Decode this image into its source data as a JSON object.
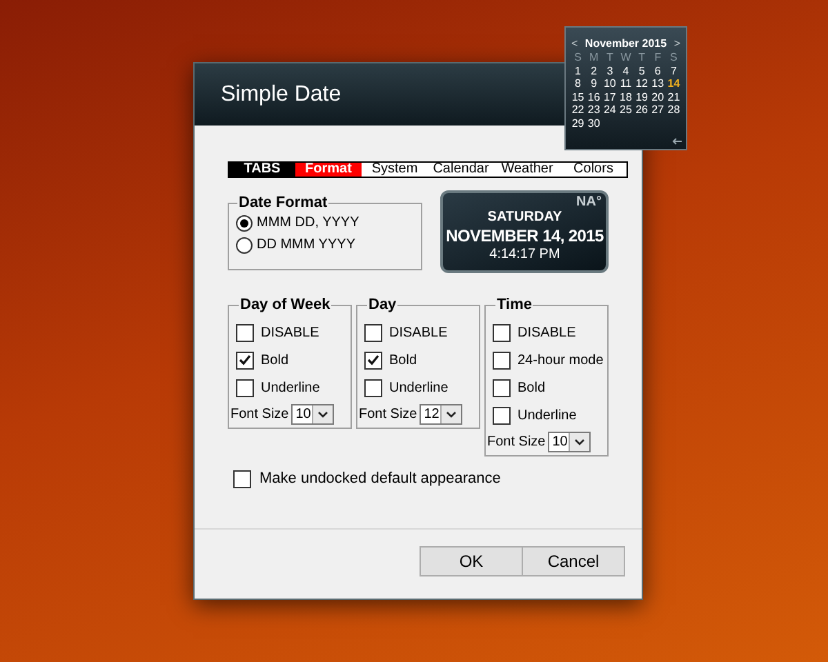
{
  "dialog": {
    "title": "Simple Date"
  },
  "tabs_label": "TABS",
  "tabs": [
    {
      "label": "Format",
      "selected": true
    },
    {
      "label": "System",
      "selected": false
    },
    {
      "label": "Calendar",
      "selected": false
    },
    {
      "label": "Weather",
      "selected": false
    },
    {
      "label": "Colors",
      "selected": false
    }
  ],
  "date_format": {
    "title": "Date Format",
    "options": [
      {
        "label": "MMM DD, YYYY",
        "selected": true
      },
      {
        "label": "DD MMM YYYY",
        "selected": false
      }
    ]
  },
  "preview": {
    "temperature": "NA°",
    "weekday": "SATURDAY",
    "date": "NOVEMBER 14, 2015",
    "time": "4:14:17 PM"
  },
  "groups": [
    {
      "title": "Day of Week",
      "options": [
        {
          "label": "DISABLE",
          "checked": false
        },
        {
          "label": "Bold",
          "checked": true
        },
        {
          "label": "Underline",
          "checked": false
        }
      ],
      "font_size_label": "Font Size",
      "font_size": "10"
    },
    {
      "title": "Day",
      "options": [
        {
          "label": "DISABLE",
          "checked": false
        },
        {
          "label": "Bold",
          "checked": true
        },
        {
          "label": "Underline",
          "checked": false
        }
      ],
      "font_size_label": "Font Size",
      "font_size": "12"
    },
    {
      "title": "Time",
      "options": [
        {
          "label": "DISABLE",
          "checked": false
        },
        {
          "label": "24-hour mode",
          "checked": false
        },
        {
          "label": "Bold",
          "checked": false
        },
        {
          "label": "Underline",
          "checked": false
        }
      ],
      "font_size_label": "Font Size",
      "font_size": "10"
    }
  ],
  "undocked_default": {
    "label": "Make undocked default appearance",
    "checked": false
  },
  "buttons": [
    "OK",
    "Cancel"
  ],
  "calendar": {
    "prev": "<",
    "month": "November 2015",
    "next": ">",
    "weekdays": [
      "S",
      "M",
      "T",
      "W",
      "T",
      "F",
      "S"
    ],
    "days": [
      {
        "label": "1",
        "selected": false
      },
      {
        "label": "2",
        "selected": false
      },
      {
        "label": "3",
        "selected": false
      },
      {
        "label": "4",
        "selected": false
      },
      {
        "label": "5",
        "selected": false
      },
      {
        "label": "6",
        "selected": false
      },
      {
        "label": "7",
        "selected": false
      },
      {
        "label": "8",
        "selected": false
      },
      {
        "label": "9",
        "selected": false
      },
      {
        "label": "10",
        "selected": false
      },
      {
        "label": "11",
        "selected": false
      },
      {
        "label": "12",
        "selected": false
      },
      {
        "label": "13",
        "selected": false
      },
      {
        "label": "14",
        "selected": true
      },
      {
        "label": "15",
        "selected": false
      },
      {
        "label": "16",
        "selected": false
      },
      {
        "label": "17",
        "selected": false
      },
      {
        "label": "18",
        "selected": false
      },
      {
        "label": "19",
        "selected": false
      },
      {
        "label": "20",
        "selected": false
      },
      {
        "label": "21",
        "selected": false
      },
      {
        "label": "22",
        "selected": false
      },
      {
        "label": "23",
        "selected": false
      },
      {
        "label": "24",
        "selected": false
      },
      {
        "label": "25",
        "selected": false
      },
      {
        "label": "26",
        "selected": false
      },
      {
        "label": "27",
        "selected": false
      },
      {
        "label": "28",
        "selected": false
      },
      {
        "label": "29",
        "selected": false
      },
      {
        "label": "30",
        "selected": false
      }
    ]
  }
}
